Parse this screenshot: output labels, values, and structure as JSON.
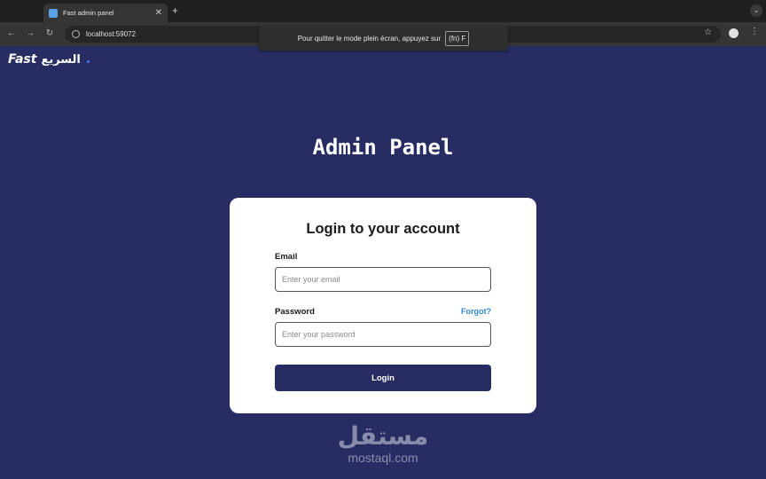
{
  "browser": {
    "tab_title": "Fast admin panel",
    "new_tab": "+",
    "tab_search": "⌄",
    "url": "localhost:59072",
    "back": "←",
    "forward": "→",
    "reload": "↻",
    "star": "☆",
    "menu": "⋮",
    "fullscreen_message": "Pour quitter le mode plein écran, appuyez sur",
    "fullscreen_key": "(fn) F"
  },
  "logo": {
    "en": "Fast",
    "ar": "السريع"
  },
  "page": {
    "title": "Admin Panel"
  },
  "login": {
    "heading": "Login to your account",
    "email_label": "Email",
    "email_placeholder": "Enter your email",
    "email_value": "",
    "password_label": "Password",
    "password_placeholder": "Enter your password",
    "password_value": "",
    "forgot_label": "Forgot?",
    "submit_label": "Login"
  },
  "watermark": {
    "ar": "مستقل",
    "en": "mostaql.com"
  },
  "colors": {
    "background": "#272c63",
    "button": "#272c63",
    "link": "#2f86c9",
    "card": "#ffffff"
  }
}
